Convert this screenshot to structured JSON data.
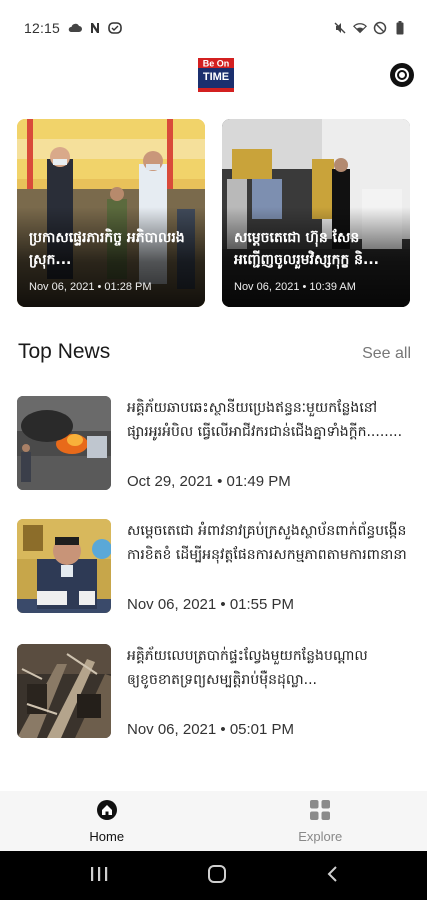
{
  "status_bar": {
    "time": "12:15",
    "left_icons": [
      "cloud-icon",
      "n-icon",
      "shield-icon"
    ],
    "right_icons": [
      "mute-icon",
      "wifi-icon",
      "dnd-icon",
      "battery-icon"
    ]
  },
  "header": {
    "logo_text_line1": "Be On",
    "logo_text_line2": "TIME",
    "settings_icon": "settings-icon"
  },
  "featured": [
    {
      "title": "ប្រកាសផ្ទេរភារកិច្ច អភិបាលរងស្រុក...",
      "date": "Nov 06, 2021",
      "time": "01:28 PM"
    },
    {
      "title": "សម្តេចតេជោ ហ៊ុន សែន អញ្ជើញចូលរួមវិស្សកុក្ខ និ...",
      "date": "Nov 06, 2021",
      "time": "10:39 AM"
    }
  ],
  "top_news": {
    "title": "Top News",
    "see_all": "See all",
    "items": [
      {
        "title": "អគ្គិភ័យឆាបឆេះស្ថានីយប្រេងឥន្ធនៈមួយកន្លែងនៅផ្សារអូរអំបិល ធ្វើលើអាជីវករជាន់ជើងគ្នាទាំងក្តីក........",
        "date": "Oct 29, 2021",
        "time": "01:49 PM"
      },
      {
        "title": "សម្តេចតេជោ អំពាវនាវគ្រប់ក្រសួងស្ថាប័នពាក់ព័ន្ធបង្កើនការខិតខំ ដើម្បីអនុវត្តផែនការសកម្មភាពតាមការពានានា",
        "date": "Nov 06, 2021",
        "time": "01:55 PM"
      },
      {
        "title": "អគ្គិភ័យលេបត្របាក់ផ្ទះល្វែងមួយកន្លែងបណ្តាលឲ្យខូចខាតទ្រព្យសម្បត្តិរាប់ម៉ឺនដុល្លា...",
        "date": "Nov 06, 2021",
        "time": "05:01 PM"
      }
    ]
  },
  "bottom_nav": {
    "home_label": "Home",
    "explore_label": "Explore"
  },
  "colors": {
    "accent": "#111111",
    "muted": "#777777",
    "nav_bg": "#f6f6f6"
  }
}
